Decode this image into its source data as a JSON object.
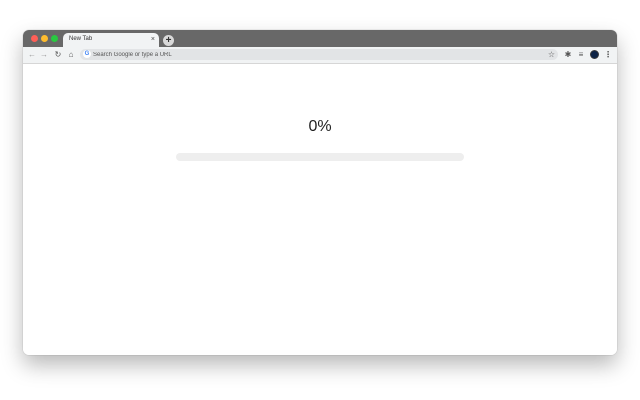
{
  "browser": {
    "tab": {
      "title": "New Tab",
      "close_glyph": "×"
    },
    "new_tab_glyph": "+",
    "window_controls": {
      "close_color": "#fe5f57",
      "minimize_color": "#febc2e",
      "maximize_color": "#29c840"
    },
    "toolbar": {
      "back_glyph": "←",
      "forward_glyph": "→",
      "reload_glyph": "↻",
      "home_glyph": "⌂",
      "search_engine_glyph": "G",
      "omnibox_placeholder": "Search Google or type a URL",
      "omnibox_value": "",
      "bookmark_glyph": "☆",
      "extensions_glyph": "✱",
      "media_glyph": "≡",
      "menu_glyph": "⋮"
    }
  },
  "page": {
    "progress": {
      "label": "0%",
      "value": 0,
      "track_color": "#eeeeee"
    }
  }
}
